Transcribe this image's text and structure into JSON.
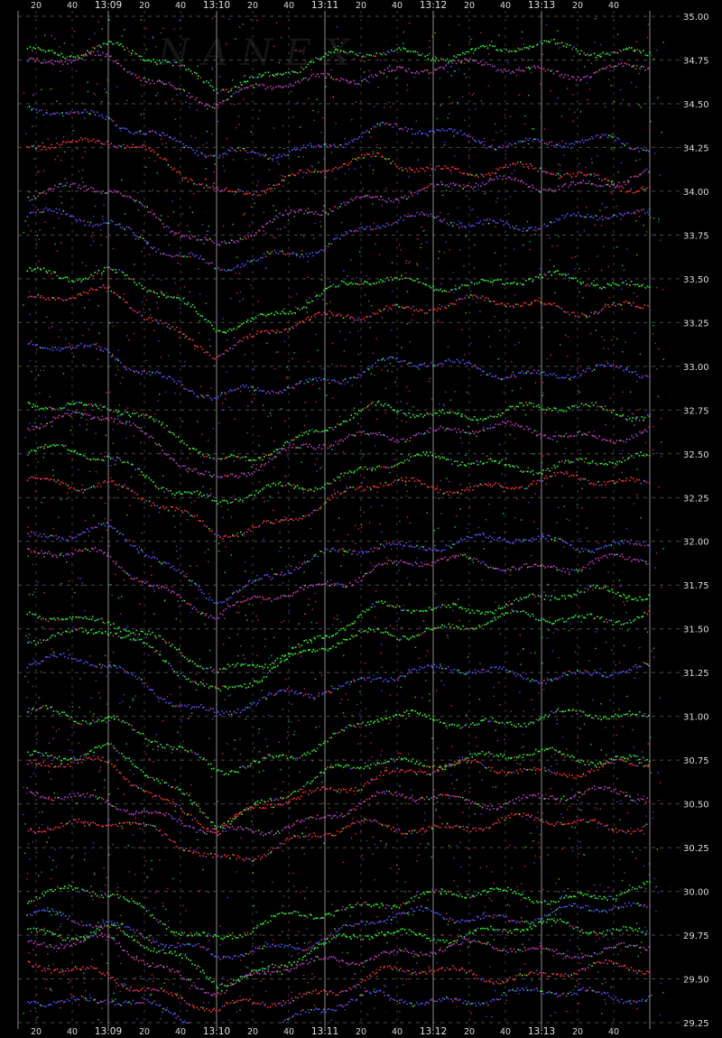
{
  "chart_data": {
    "type": "scatter",
    "title": "",
    "watermark": "NANEX",
    "xlabel": "",
    "ylabel": "",
    "x_major_ticks": [
      "13:09",
      "13:10",
      "13:11",
      "13:12",
      "13:13"
    ],
    "x_minor_ticks": [
      "20",
      "40"
    ],
    "y_ticks": [
      "35.00",
      "34.75",
      "34.50",
      "34.25",
      "34.00",
      "33.75",
      "33.50",
      "33.25",
      "33.00",
      "32.75",
      "32.50",
      "32.25",
      "32.00",
      "31.75",
      "31.50",
      "31.25",
      "31.00",
      "30.75",
      "30.50",
      "30.25",
      "30.00",
      "29.75",
      "29.50",
      "29.25"
    ],
    "ylim": [
      29.25,
      35.0
    ],
    "xlim": [
      "13:08:10",
      "13:13:55"
    ],
    "grid": true,
    "background": "#000000",
    "series_colors": {
      "bid_exchange": "#28ff28",
      "ask_exchange": "#ff3030",
      "other_exchange": "#5050ff",
      "mixed": "#c040c0"
    },
    "series": [
      {
        "level": 34.82,
        "end": 34.82,
        "dip": 0.2,
        "color": "#28ff28"
      },
      {
        "level": 34.74,
        "end": 34.7,
        "dip": 0.22,
        "color": "#c040c0"
      },
      {
        "level": 34.45,
        "end": 34.25,
        "dip": 0.28,
        "color": "#5050ff"
      },
      {
        "level": 34.3,
        "end": 34.05,
        "dip": 0.3,
        "color": "#ff3030"
      },
      {
        "level": 34.0,
        "end": 34.08,
        "dip": 0.3,
        "color": "#c040c0"
      },
      {
        "level": 33.85,
        "end": 33.85,
        "dip": 0.32,
        "color": "#5050ff"
      },
      {
        "level": 33.55,
        "end": 33.48,
        "dip": 0.32,
        "color": "#28ff28"
      },
      {
        "level": 33.4,
        "end": 33.35,
        "dip": 0.3,
        "color": "#ff3030"
      },
      {
        "level": 33.1,
        "end": 32.95,
        "dip": 0.3,
        "color": "#5050ff"
      },
      {
        "level": 32.8,
        "end": 32.75,
        "dip": 0.35,
        "color": "#28ff28"
      },
      {
        "level": 32.7,
        "end": 32.62,
        "dip": 0.33,
        "color": "#c040c0"
      },
      {
        "level": 32.5,
        "end": 32.45,
        "dip": 0.3,
        "color": "#28ff28"
      },
      {
        "level": 32.35,
        "end": 32.35,
        "dip": 0.32,
        "color": "#ff3030"
      },
      {
        "level": 32.05,
        "end": 32.0,
        "dip": 0.35,
        "color": "#5050ff"
      },
      {
        "level": 31.92,
        "end": 31.88,
        "dip": 0.35,
        "color": "#c040c0"
      },
      {
        "level": 31.58,
        "end": 31.72,
        "dip": 0.35,
        "color": "#28ff28"
      },
      {
        "level": 31.48,
        "end": 31.6,
        "dip": 0.32,
        "color": "#28ff28"
      },
      {
        "level": 31.3,
        "end": 31.25,
        "dip": 0.3,
        "color": "#5050ff"
      },
      {
        "level": 31.02,
        "end": 31.0,
        "dip": 0.35,
        "color": "#28ff28"
      },
      {
        "level": 30.8,
        "end": 30.78,
        "dip": 0.38,
        "color": "#28ff28"
      },
      {
        "level": 30.72,
        "end": 30.72,
        "dip": 0.35,
        "color": "#ff3030"
      },
      {
        "level": 30.55,
        "end": 30.55,
        "dip": 0.25,
        "color": "#c040c0"
      },
      {
        "level": 30.4,
        "end": 30.4,
        "dip": 0.2,
        "color": "#ff3030"
      },
      {
        "level": 29.98,
        "end": 30.0,
        "dip": 0.25,
        "color": "#28ff28"
      },
      {
        "level": 29.85,
        "end": 29.9,
        "dip": 0.25,
        "color": "#5050ff"
      },
      {
        "level": 29.78,
        "end": 29.8,
        "dip": 0.28,
        "color": "#28ff28"
      },
      {
        "level": 29.7,
        "end": 29.68,
        "dip": 0.25,
        "color": "#c040c0"
      },
      {
        "level": 29.55,
        "end": 29.55,
        "dip": 0.25,
        "color": "#ff3030"
      },
      {
        "level": 29.4,
        "end": 29.42,
        "dip": 0.2,
        "color": "#5050ff"
      }
    ]
  }
}
